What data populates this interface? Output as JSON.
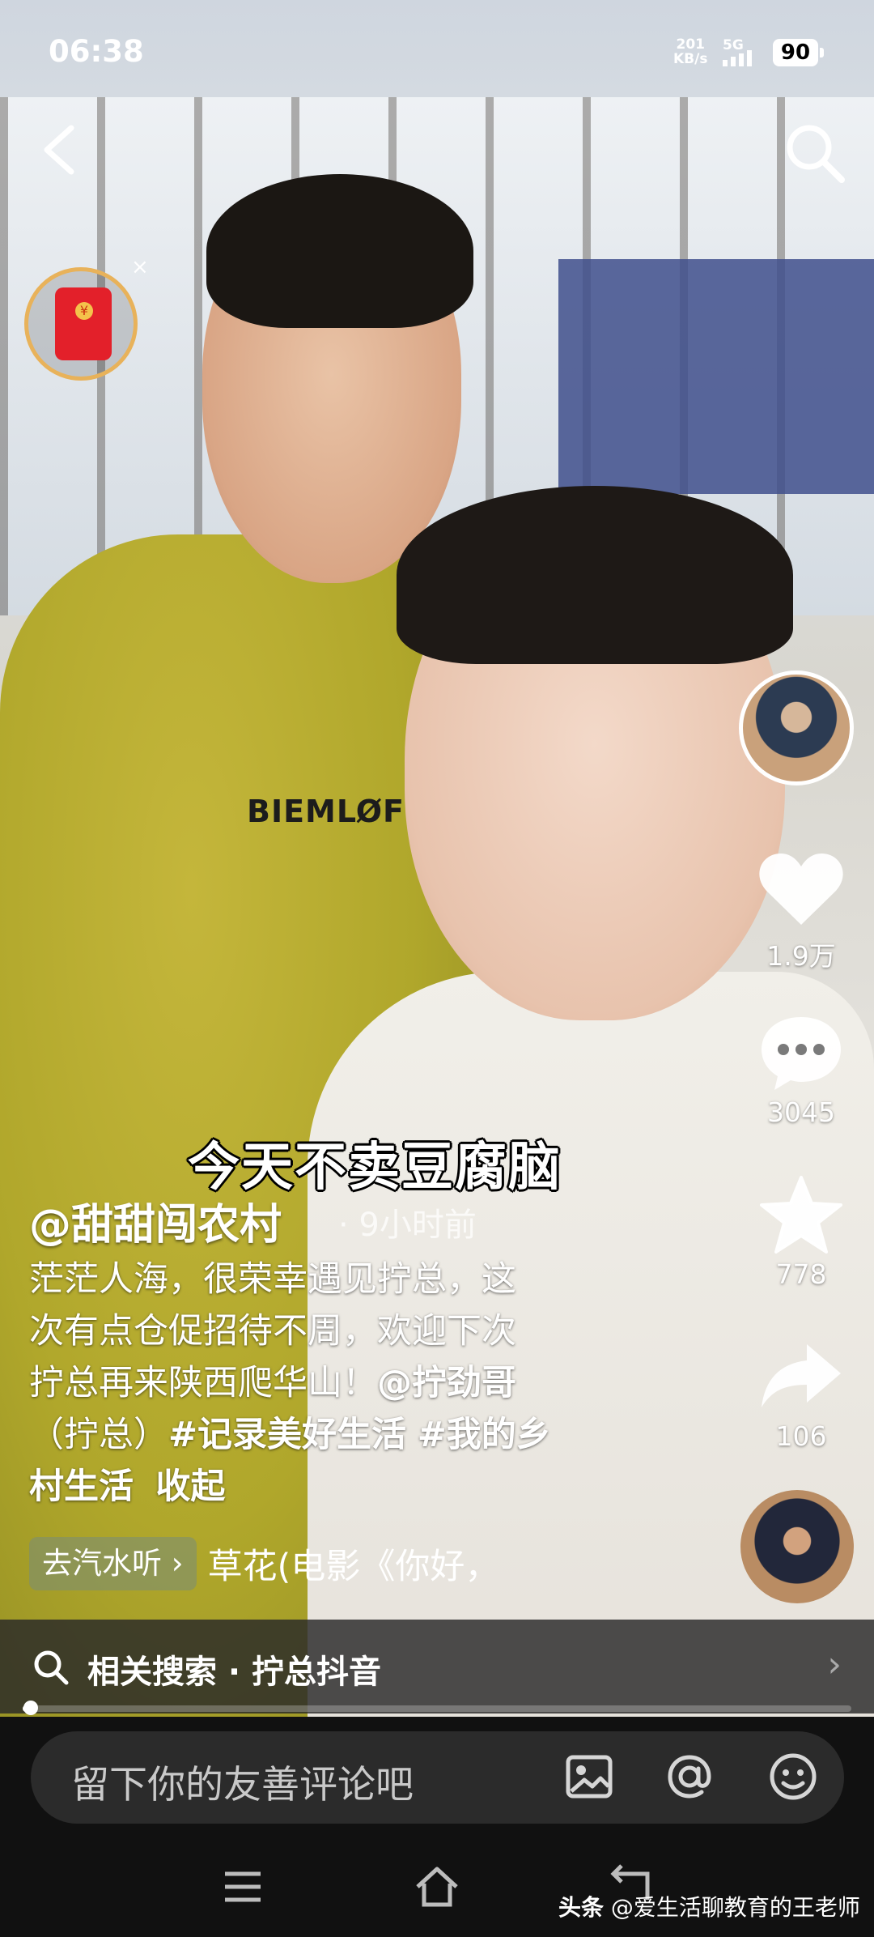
{
  "status_bar": {
    "time": "06:38",
    "net_speed_value": "201",
    "net_speed_unit": "KB/s",
    "network": "5G",
    "battery": "90"
  },
  "video": {
    "overlay_caption": "今天不卖豆腐脑",
    "shirt_print": "BIEMLØFEN"
  },
  "right_rail": {
    "like_count": "1.9万",
    "comment_count": "3045",
    "favorite_count": "778",
    "share_count": "106"
  },
  "post": {
    "author": "@甜甜闯农村",
    "time_ago": "· 9小时前",
    "desc_line1": "茫茫人海，很荣幸遇见拧总，这",
    "desc_line2": "次有点仓促招待不周，欢迎下次",
    "desc_line3_prefix": "拧总再来陕西爬华山！",
    "mention": "@拧劲哥",
    "desc_line4_prefix": "（拧总）",
    "hashtag1": "#记录美好生活",
    "hashtag2": "#我的乡",
    "desc_line5": "村生活",
    "collapse": "收起",
    "music_pill": "去汽水听 ›",
    "music_title": "草花(电影《你好，"
  },
  "related": {
    "label": "相关搜索 · 拧总抖音",
    "chevron": "›"
  },
  "progress": {
    "value": 0.01
  },
  "comment_bar": {
    "placeholder": "留下你的友善评论吧"
  },
  "watermark": {
    "source": "头条",
    "author": "@爱生活聊教育的王老师"
  },
  "colors": {
    "accent_red": "#e3202a",
    "redpacket_ring": "#e8b25a",
    "comment_bg": "#2b2b2b"
  }
}
